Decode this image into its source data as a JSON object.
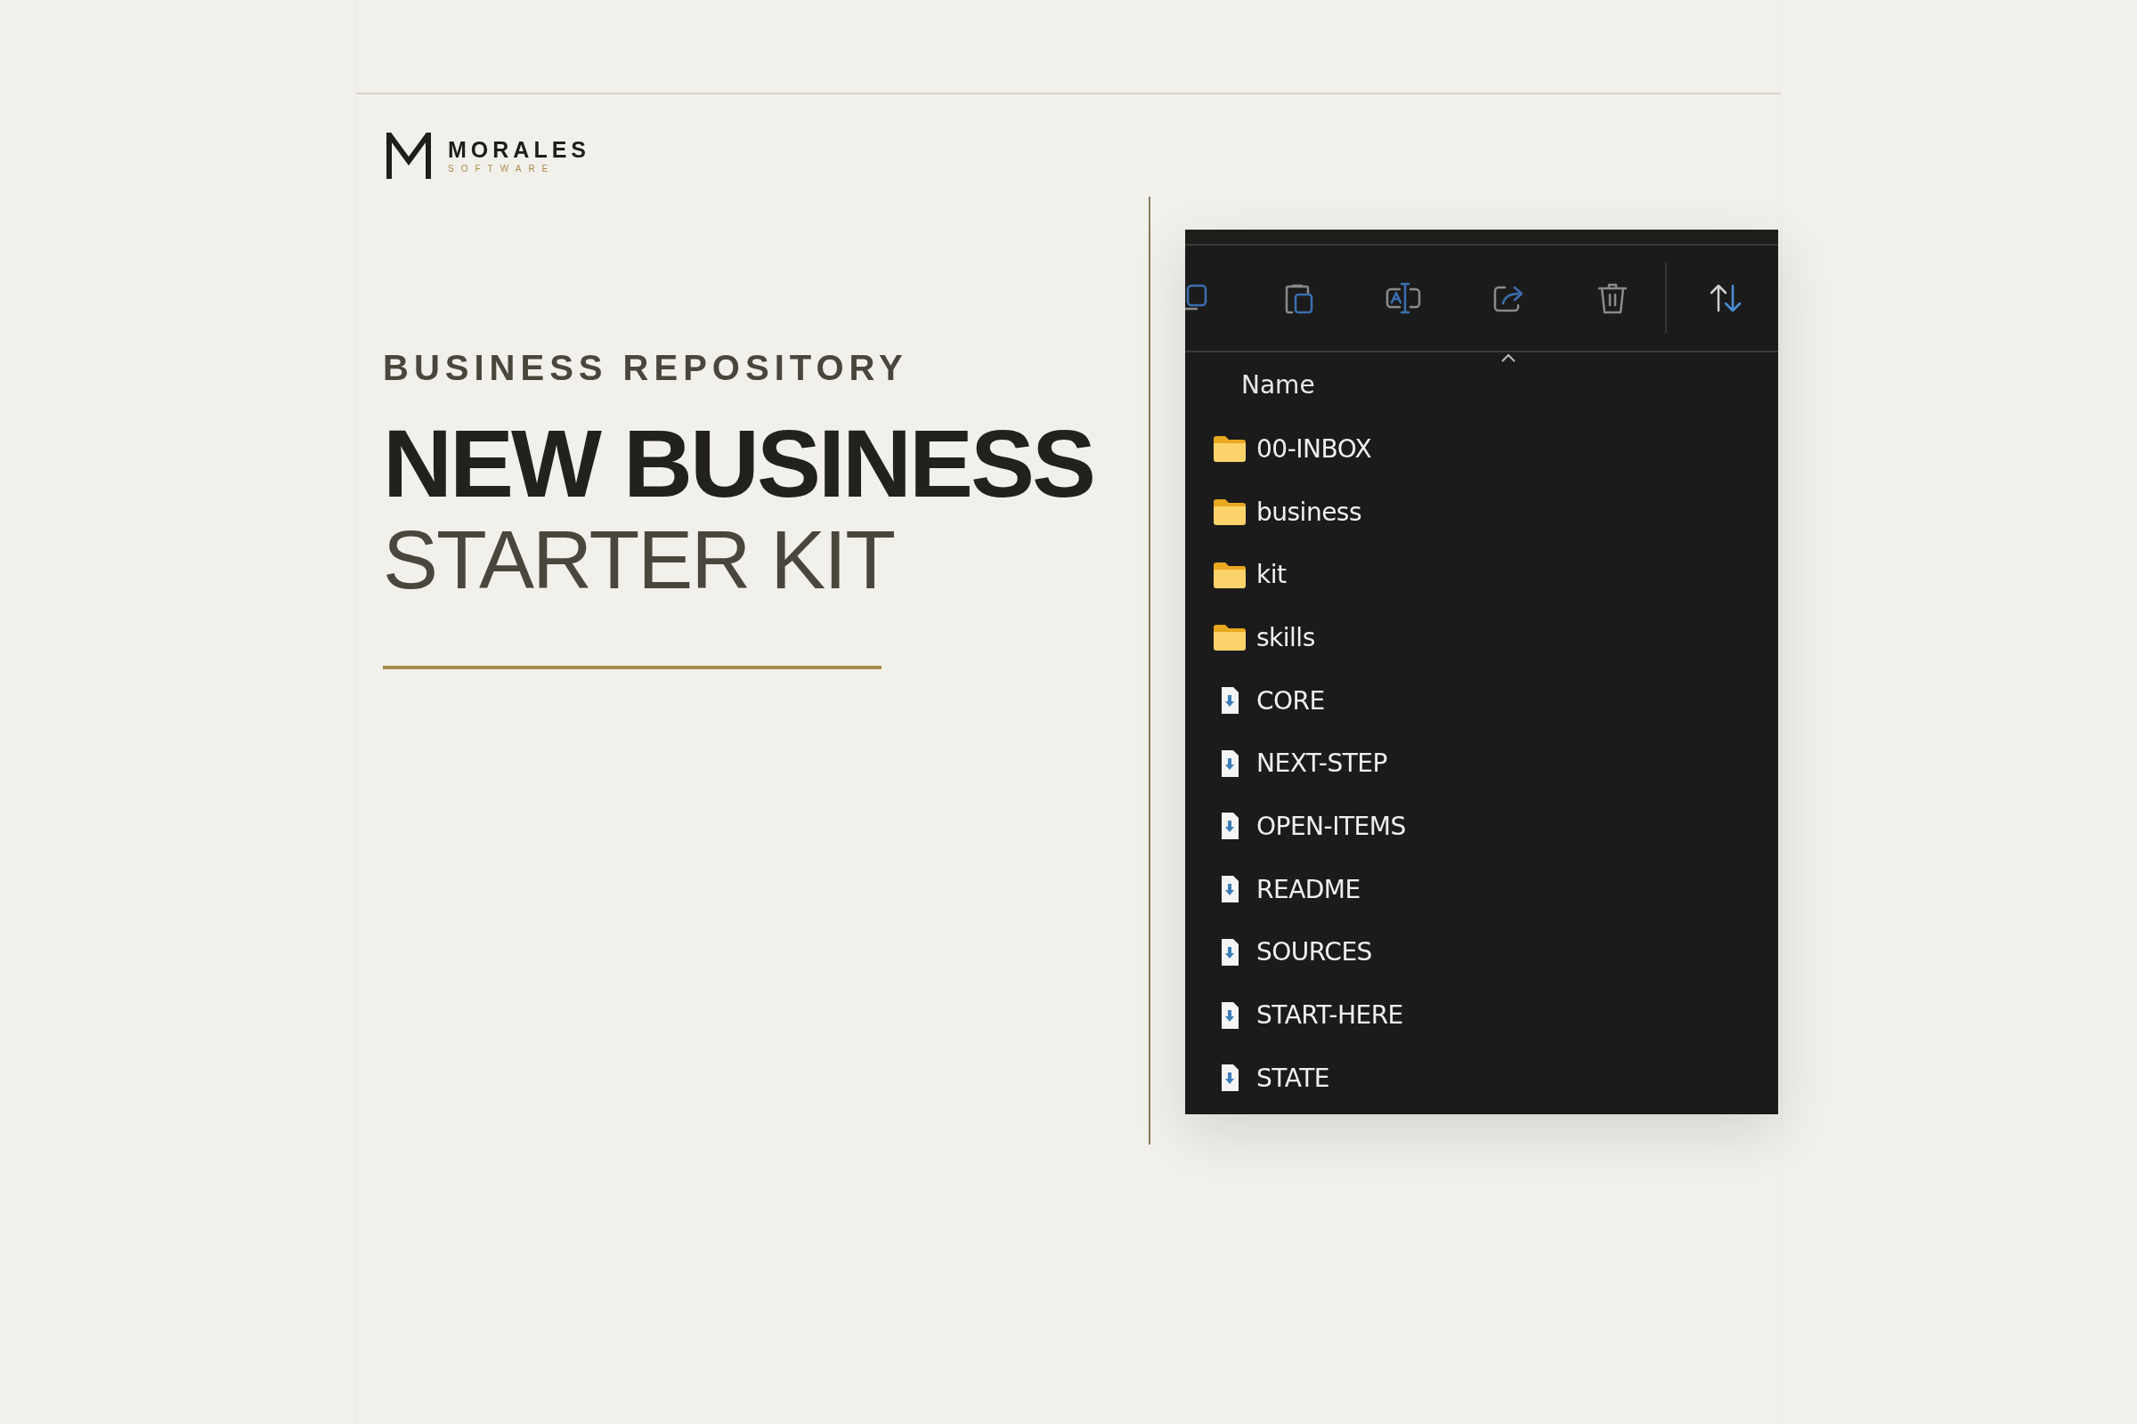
{
  "brand": {
    "name": "MORALES",
    "tagline": "SOFTWARE"
  },
  "hero": {
    "eyebrow": "BUSINESS REPOSITORY",
    "title_line_1": "NEW BUSINESS",
    "title_line_2": "STARTER KIT"
  },
  "explorer": {
    "toolbar": [
      {
        "kind": "copy"
      },
      {
        "kind": "paste"
      },
      {
        "kind": "rename"
      },
      {
        "kind": "share"
      },
      {
        "kind": "delete"
      },
      {
        "kind": "sort"
      }
    ],
    "column_header": "Name",
    "items": [
      {
        "name": "00-INBOX",
        "kind": "folder"
      },
      {
        "name": "business",
        "kind": "folder"
      },
      {
        "name": "kit",
        "kind": "folder"
      },
      {
        "name": "skills",
        "kind": "folder"
      },
      {
        "name": "CORE",
        "kind": "file"
      },
      {
        "name": "NEXT-STEP",
        "kind": "file"
      },
      {
        "name": "OPEN-ITEMS",
        "kind": "file"
      },
      {
        "name": "README",
        "kind": "file"
      },
      {
        "name": "SOURCES",
        "kind": "file"
      },
      {
        "name": "START-HERE",
        "kind": "file"
      },
      {
        "name": "STATE",
        "kind": "file"
      }
    ]
  }
}
